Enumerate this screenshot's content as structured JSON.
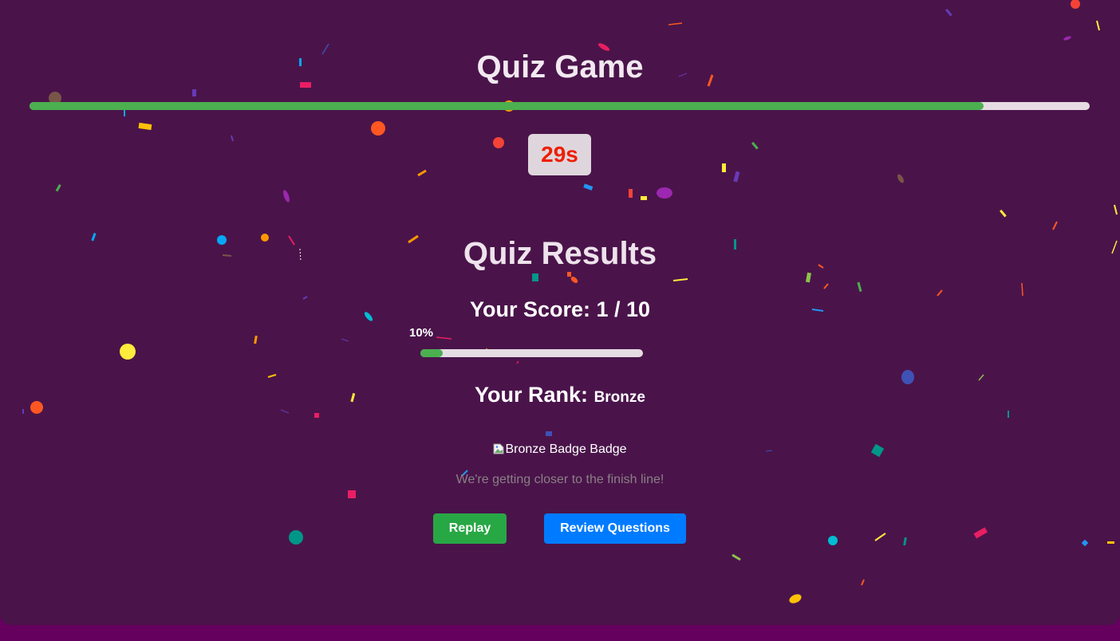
{
  "header": {
    "title": "Quiz Game"
  },
  "timer": {
    "progress_fraction": 0.9,
    "label": "29s",
    "color": "#ee1e00"
  },
  "results": {
    "title": "Quiz Results",
    "score_label": "Your Score: 1 / 10",
    "score_percent_label": "10%",
    "score_fraction": 0.1,
    "rank_label": "Your Rank:",
    "rank_value": "Bronze",
    "badge_alt_text": "Bronze Badge Badge",
    "message": "We're getting closer to the finish line!"
  },
  "buttons": {
    "replay": "Replay",
    "review": "Review Questions"
  },
  "colors": {
    "background": "#4a144a",
    "progress_fill": "#4caf50",
    "replay_button": "#28a745",
    "review_button": "#007bff"
  }
}
